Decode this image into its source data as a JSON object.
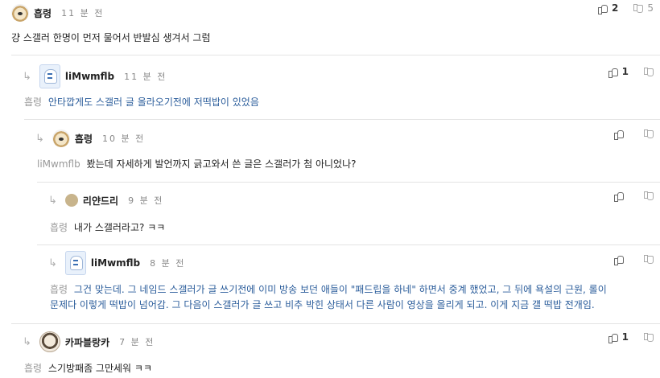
{
  "comments": [
    {
      "nick": "흡령",
      "time": "11 분 전",
      "up": "2",
      "down": "5",
      "reply_to": "",
      "text": "걍 스갤러 한명이 먼저 물어서 반발심 생겨서 그럼"
    },
    {
      "nick": "liMwmflb",
      "time": "11 분 전",
      "up": "1",
      "down": "",
      "reply_to": "흡령",
      "text": "안타깝게도 스갤러 글 올라오기전에 저떡밥이 있었음"
    },
    {
      "nick": "흡령",
      "time": "10 분 전",
      "up": "",
      "down": "",
      "reply_to": "liMwmflb",
      "text": "봤는데 자세하게 발언까지 긁고와서 쓴 글은 스갤러가 첨 아니었나?"
    },
    {
      "nick": "리얀드리",
      "time": "9 분 전",
      "up": "",
      "down": "",
      "reply_to": "흡령",
      "text": "내가 스갤러라고? ㅋㅋ"
    },
    {
      "nick": "liMwmflb",
      "time": "8 분 전",
      "up": "",
      "down": "",
      "reply_to": "흡령",
      "text_line1": "그건 맞는데. 그 네임드 스갤러가 글 쓰기전에 이미 방송 보던 애들이 \"패드립을 하네\" 하면서 중계 했었고, 그 뒤에 욕설의 근원, 롤이",
      "text_line2": "문제다 이렇게 떡밥이 넘어감. 그 다음이 스갤러가 글 쓰고 비추 박힌 상태서 다른 사람이 영상을 올리게 되고. 이게 지금 걜 떡밥 전개임."
    },
    {
      "nick": "카파블랑카",
      "time": "7 분 전",
      "up": "1",
      "down": "",
      "reply_to": "흡령",
      "text": "스기방패좀 그만세워 ㅋㅋ"
    }
  ]
}
